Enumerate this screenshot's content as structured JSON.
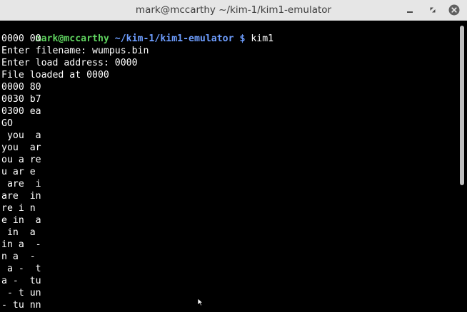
{
  "window": {
    "title": "mark@mccarthy ~/kim-1/kim1-emulator"
  },
  "terminal": {
    "prompt": {
      "user_host": "mark@mccarthy",
      "path": " ~/kim-1/kim1-emulator $",
      "command": " kim1"
    },
    "lines": [
      "0000 00",
      "Enter filename: wumpus.bin",
      "Enter load address: 0000",
      "File loaded at 0000",
      "0000 80",
      "0030 b7",
      "0300 ea",
      "GO",
      " you  a",
      "you  ar",
      "ou a re",
      "u ar e ",
      " are  i",
      "are  in",
      "re i n ",
      "e in  a",
      " in  a ",
      "in a  -",
      "n a  - ",
      " a -  t",
      "a -  tu",
      " - t un",
      "- tu nn"
    ]
  },
  "colors": {
    "background": "#000000",
    "text": "#ffffff",
    "prompt_user": "#5fd35f",
    "prompt_path": "#6e9eff",
    "titlebar": "#e6e6e6"
  },
  "icons": {
    "minimize": "minimize-icon",
    "maximize": "maximize-icon",
    "close": "close-icon",
    "mouse_pointer": "mouse-pointer-icon"
  }
}
